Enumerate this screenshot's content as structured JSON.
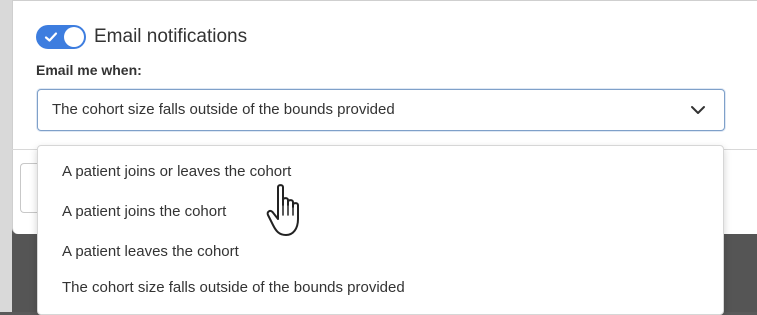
{
  "notifications": {
    "toggle_label": "Email notifications",
    "enabled": true,
    "accent_color": "#3d7ddf"
  },
  "email_when": {
    "label": "Email me when:",
    "selected_value": "The cohort size falls outside of the bounds provided",
    "options": [
      "A patient joins or leaves the cohort",
      "A patient joins the cohort",
      "A patient leaves the cohort",
      "The cohort size falls outside of the bounds provided"
    ]
  },
  "icons": {
    "toggle": "check-icon",
    "select": "chevron-down-icon",
    "cursor": "hand-pointer-icon"
  }
}
